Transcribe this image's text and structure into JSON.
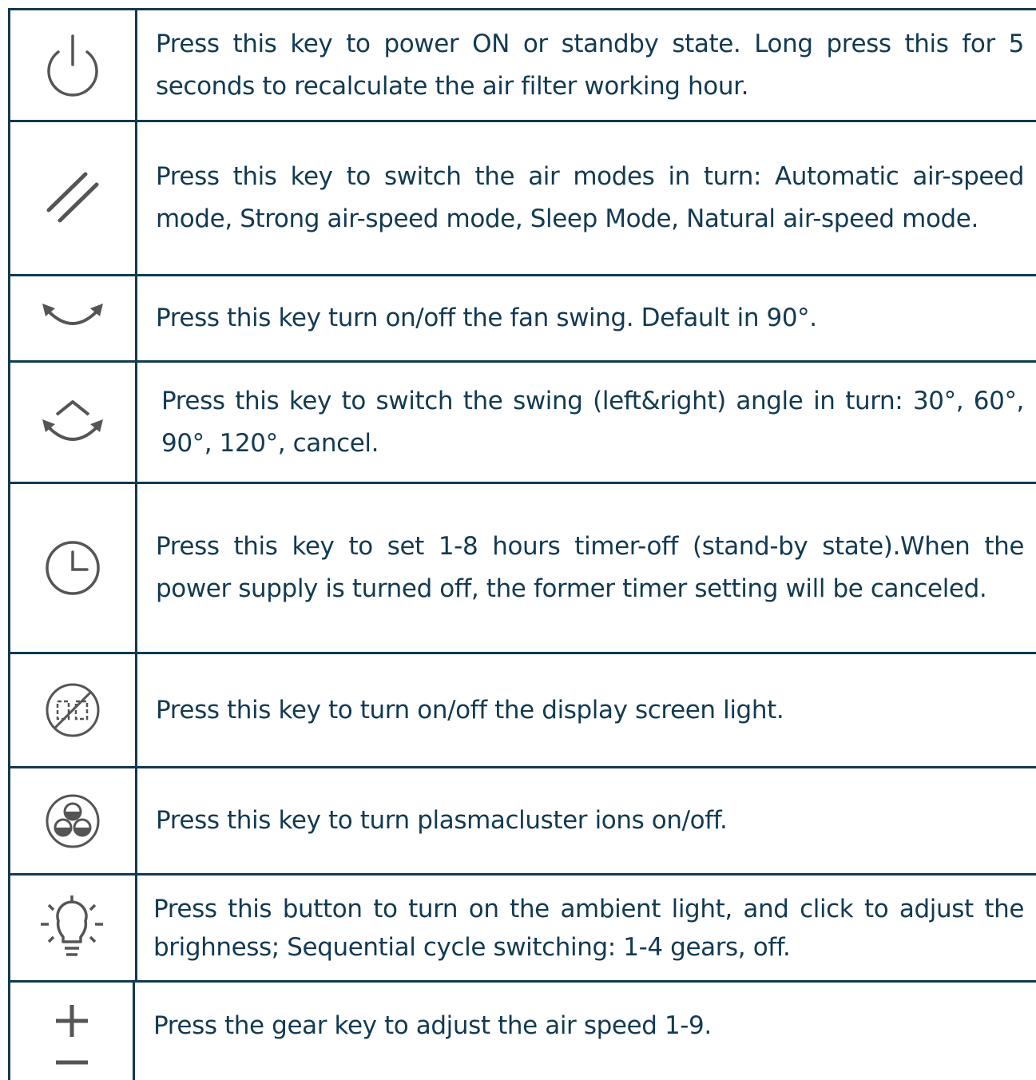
{
  "colors": {
    "border": "#123a52",
    "text": "#123a52",
    "icon": "#555555"
  },
  "rows": [
    {
      "icon": "power-icon",
      "text": "Press this key to power ON or standby state. Long press this for 5 seconds to recalculate the air filter working hour."
    },
    {
      "icon": "air-mode-icon",
      "text": "Press this key to switch the air modes in turn: Automatic air-speed mode, Strong air-speed mode, Sleep Mode, Natural air-speed mode."
    },
    {
      "icon": "fan-swing-icon",
      "text": "Press this key turn on/off the fan swing. Default in 90°."
    },
    {
      "icon": "swing-angle-icon",
      "text": "Press this key to switch the swing (left&right) angle in turn: 30°, 60°, 90°, 120°, cancel."
    },
    {
      "icon": "timer-icon",
      "text": "Press this key to set 1-8 hours timer-off (stand-by state).When the power supply is turned off, the former timer setting will be canceled."
    },
    {
      "icon": "display-off-icon",
      "text": "Press this key to turn on/off the display screen light."
    },
    {
      "icon": "plasmacluster-icon",
      "text": "Press this key to turn plasmacluster ions on/off."
    },
    {
      "icon": "ambient-light-icon",
      "text": "Press this button to turn on the ambient light, and click to adjust the brighness; Sequential cycle switching: 1-4 gears, off."
    },
    {
      "icon": "plus-minus-icon",
      "text": "Press the gear key to adjust the air speed 1-9."
    }
  ]
}
